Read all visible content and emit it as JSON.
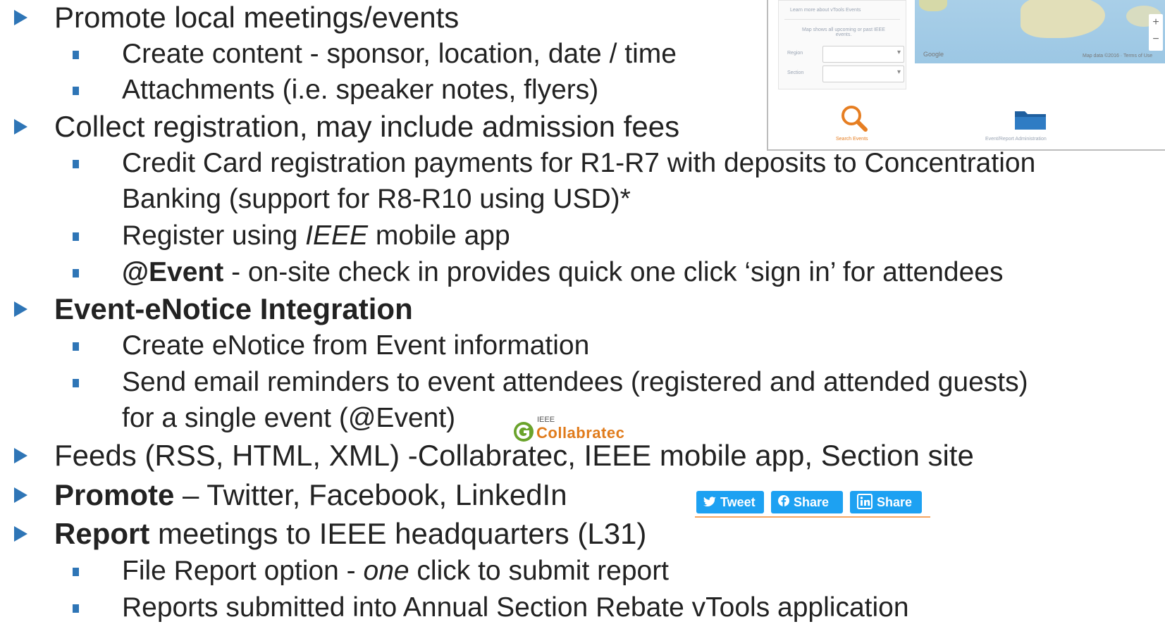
{
  "bullets": [
    {
      "text": "Promote local meetings/events"
    },
    {
      "text": "Create content - sponsor, location, date / time"
    },
    {
      "text": "Attachments (i.e. speaker notes, flyers)"
    },
    {
      "text": "Collect registration, may include admission fees"
    },
    {
      "text": "Credit Card registration payments for R1-R7 with deposits to Concentration"
    },
    {
      "text": "Banking (support for R8-R10 using USD)*"
    },
    {
      "pre": "Register using ",
      "em": "IEEE",
      "post": " mobile app"
    },
    {
      "strong": "@Event",
      "post": "  - on-site check in provides quick one click ‘sign in’ for attendees"
    },
    {
      "strong": "Event-eNotice Integration"
    },
    {
      "text": "Create eNotice from Event information"
    },
    {
      "text": "Send email reminders to event attendees (registered and attended guests)"
    },
    {
      "text": "for a single event (@Event)"
    },
    {
      "text": "Feeds (RSS, HTML, XML) -Collabratec, IEEE mobile app, Section site"
    },
    {
      "strong": "Promote",
      "post": " – Twitter, Facebook, LinkedIn"
    },
    {
      "strong": "Report",
      "post": " meetings to IEEE headquarters (L31)"
    },
    {
      "pre": "File Report option - ",
      "em": "one",
      "post": " click to submit report"
    },
    {
      "text": "Reports submitted into Annual Section Rebate vTools application"
    }
  ],
  "thumbnail": {
    "learn_more": "Learn more about vTools Events",
    "map_note": "Map shows all upcoming or past IEEE events.",
    "region_label": "Region",
    "section_label": "Section",
    "google_label": "Google",
    "map_footer": "Map data ©2016 · Terms of Use",
    "search_events": "Search Events",
    "admin_label": "Event/Report Administration"
  },
  "collabratec": {
    "top": "IEEE",
    "name": "Collabratec"
  },
  "share_buttons": [
    {
      "label": "Tweet",
      "icon": "twitter-bird-icon"
    },
    {
      "label": "Share",
      "icon": "facebook-icon"
    },
    {
      "label": "Share",
      "icon": "linkedin-icon"
    }
  ],
  "colors": {
    "bullet": "#2E75B6",
    "share_button": "#1da1f2",
    "collabratec_green": "#6aa32b",
    "collabratec_orange": "#e07b1b"
  }
}
